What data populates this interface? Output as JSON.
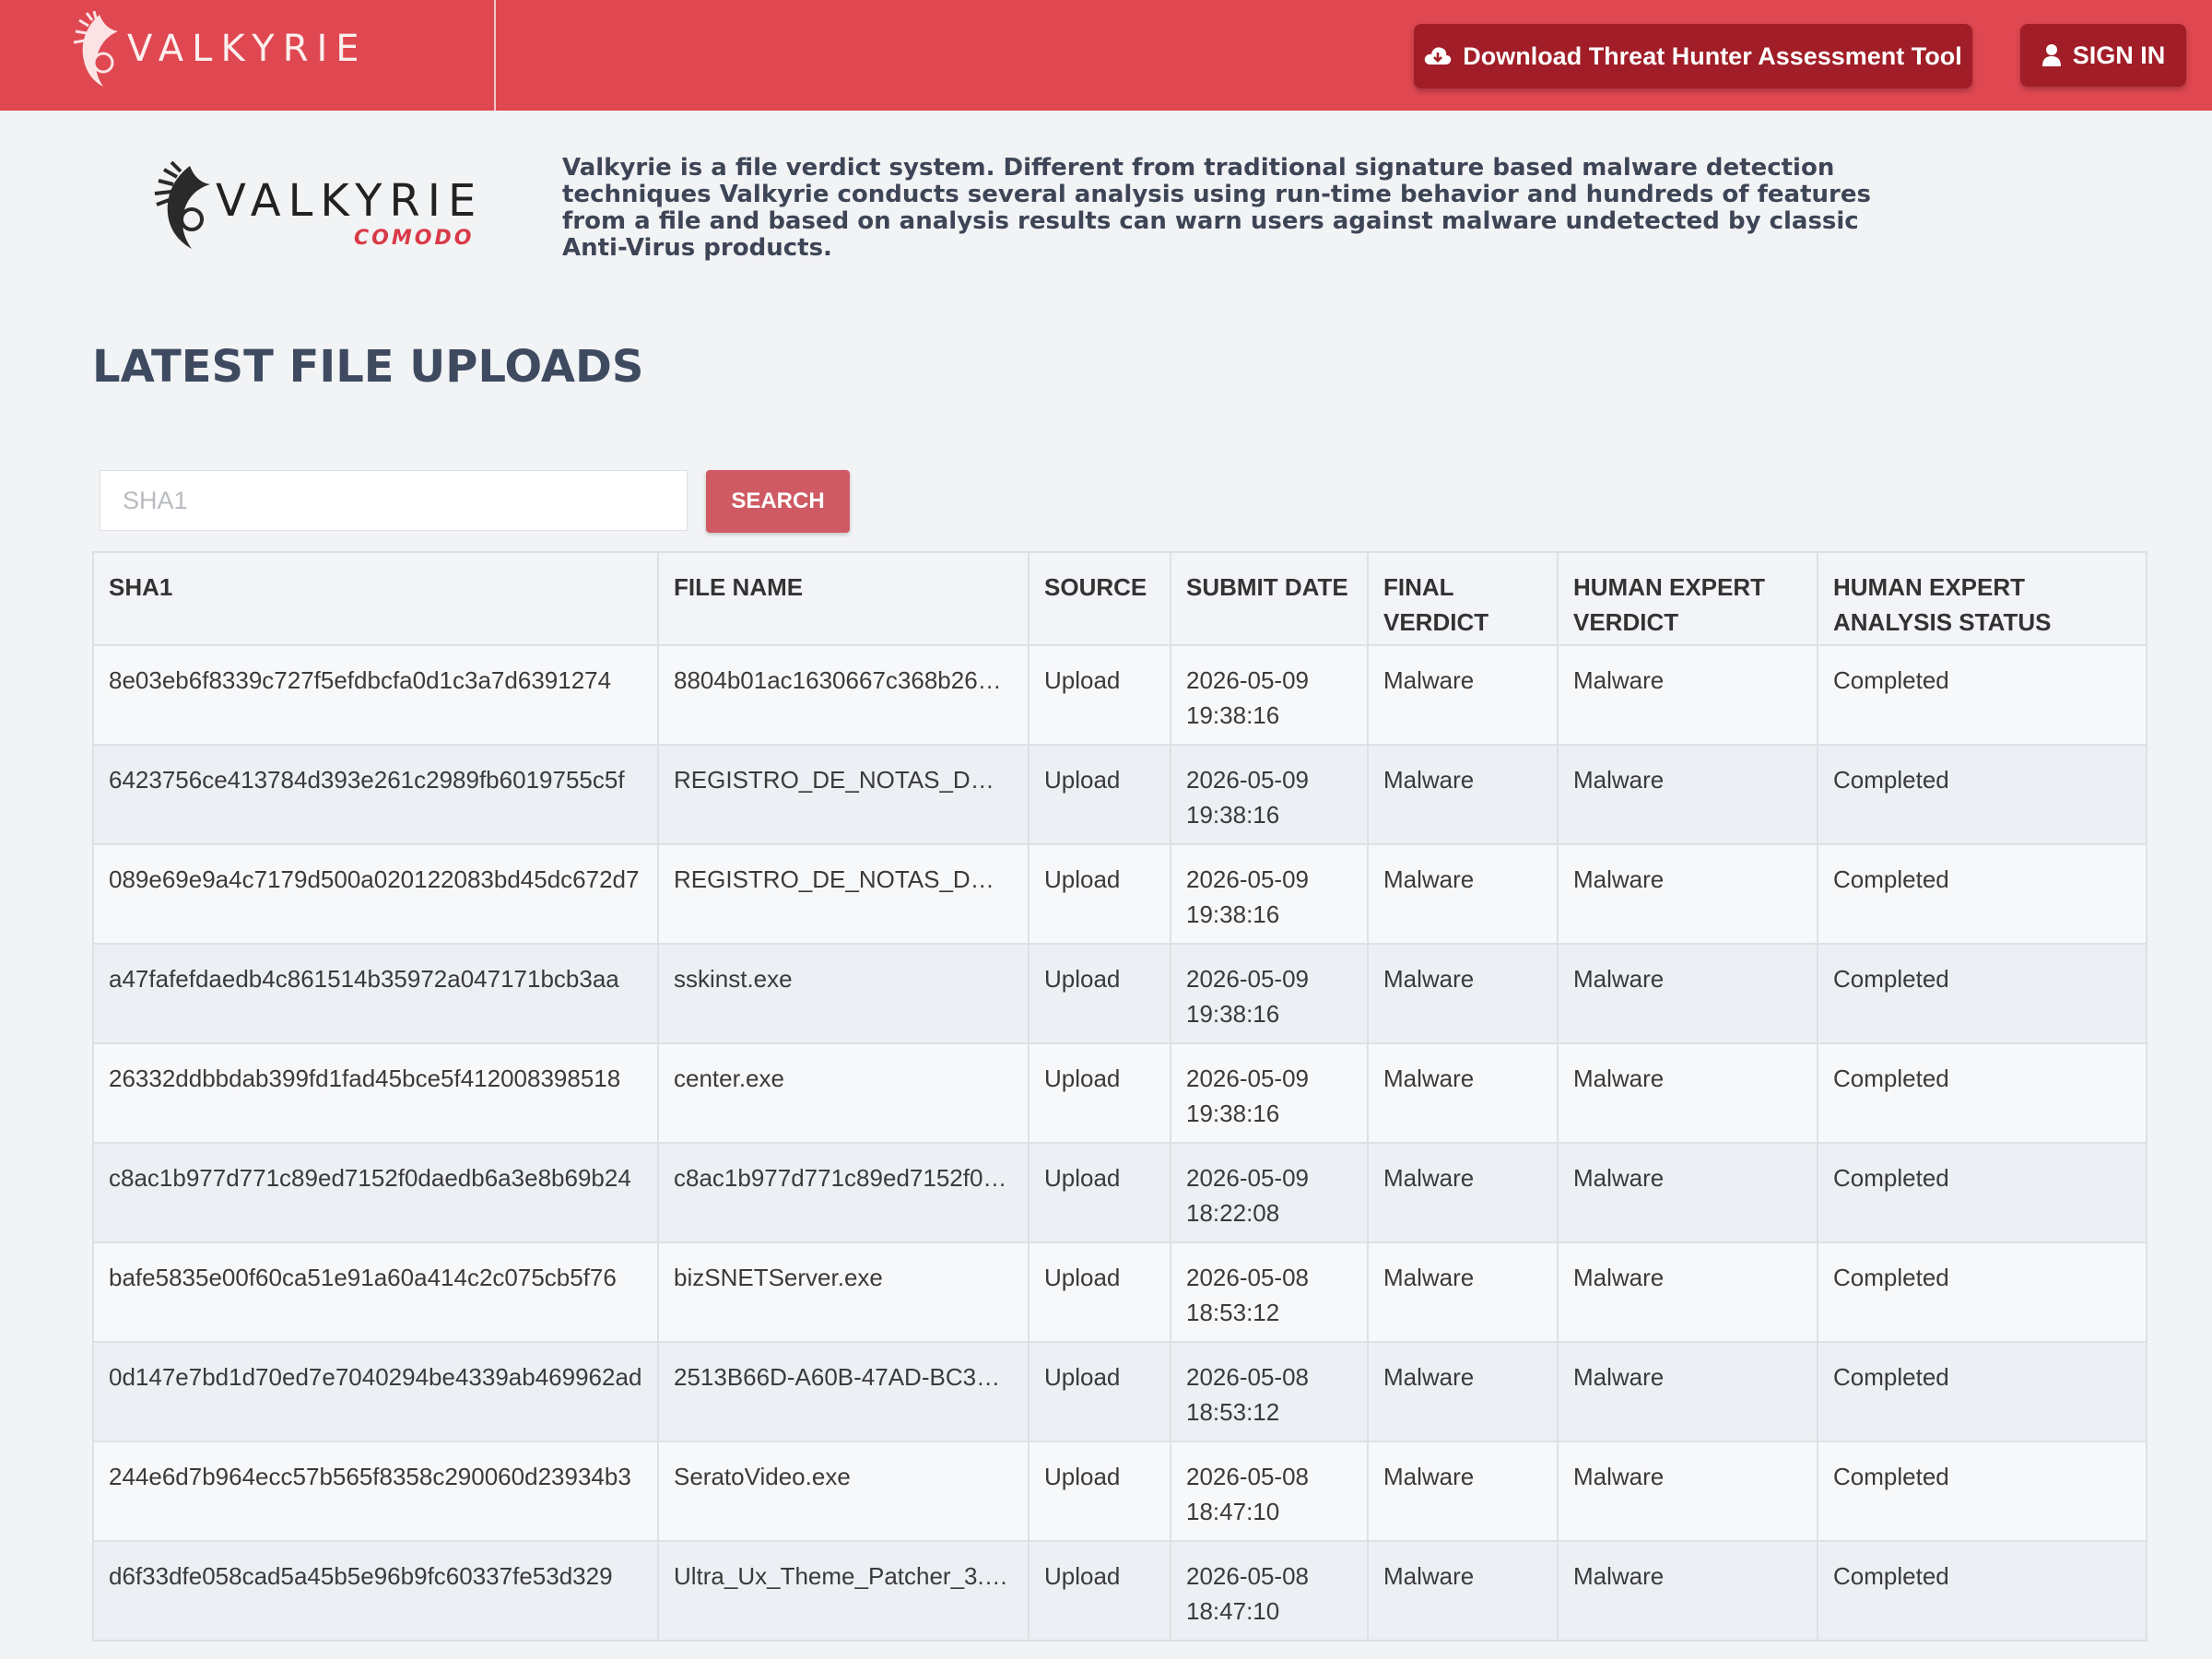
{
  "header": {
    "brand_text": "VALKYRIE",
    "download_label": "Download Threat Hunter Assessment Tool",
    "signin_label": "SIGN IN"
  },
  "intro": {
    "logo_text": "VALKYRIE",
    "logo_sub": "COMODO",
    "description": "Valkyrie is a file verdict system. Different from traditional signature based malware detection techniques Valkyrie conducts several analysis using run-time behavior and hundreds of features from a file and based on analysis results can warn users against malware undetected by classic Anti-Virus products."
  },
  "section_title": "LATEST FILE UPLOADS",
  "search": {
    "placeholder": "SHA1",
    "button_label": "SEARCH"
  },
  "table": {
    "columns": [
      "SHA1",
      "FILE NAME",
      "SOURCE",
      "SUBMIT DATE",
      "FINAL VERDICT",
      "HUMAN EXPERT VERDICT",
      "HUMAN EXPERT ANALYSIS STATUS"
    ],
    "rows": [
      {
        "sha1": "8e03eb6f8339c727f5efdbcfa0d1c3a7d6391274",
        "file_name": "8804b01ac1630667c368b26…",
        "source": "Upload",
        "date": "2026-05-09",
        "time": "19:38:16",
        "final_verdict": "Malware",
        "expert_verdict": "Malware",
        "status": "Completed"
      },
      {
        "sha1": "6423756ce413784d393e261c2989fb6019755c5f",
        "file_name": "REGISTRO_DE_NOTAS_D…",
        "source": "Upload",
        "date": "2026-05-09",
        "time": "19:38:16",
        "final_verdict": "Malware",
        "expert_verdict": "Malware",
        "status": "Completed"
      },
      {
        "sha1": "089e69e9a4c7179d500a020122083bd45dc672d7",
        "file_name": "REGISTRO_DE_NOTAS_D…",
        "source": "Upload",
        "date": "2026-05-09",
        "time": "19:38:16",
        "final_verdict": "Malware",
        "expert_verdict": "Malware",
        "status": "Completed"
      },
      {
        "sha1": "a47fafefdaedb4c861514b35972a047171bcb3aa",
        "file_name": "sskinst.exe",
        "source": "Upload",
        "date": "2026-05-09",
        "time": "19:38:16",
        "final_verdict": "Malware",
        "expert_verdict": "Malware",
        "status": "Completed"
      },
      {
        "sha1": "26332ddbbdab399fd1fad45bce5f412008398518",
        "file_name": "center.exe",
        "source": "Upload",
        "date": "2026-05-09",
        "time": "19:38:16",
        "final_verdict": "Malware",
        "expert_verdict": "Malware",
        "status": "Completed"
      },
      {
        "sha1": "c8ac1b977d771c89ed7152f0daedb6a3e8b69b24",
        "file_name": "c8ac1b977d771c89ed7152f0…",
        "source": "Upload",
        "date": "2026-05-09",
        "time": "18:22:08",
        "final_verdict": "Malware",
        "expert_verdict": "Malware",
        "status": "Completed"
      },
      {
        "sha1": "bafe5835e00f60ca51e91a60a414c2c075cb5f76",
        "file_name": "bizSNETServer.exe",
        "source": "Upload",
        "date": "2026-05-08",
        "time": "18:53:12",
        "final_verdict": "Malware",
        "expert_verdict": "Malware",
        "status": "Completed"
      },
      {
        "sha1": "0d147e7bd1d70ed7e7040294be4339ab469962ad",
        "file_name": "2513B66D-A60B-47AD-BC3…",
        "source": "Upload",
        "date": "2026-05-08",
        "time": "18:53:12",
        "final_verdict": "Malware",
        "expert_verdict": "Malware",
        "status": "Completed"
      },
      {
        "sha1": "244e6d7b964ecc57b565f8358c290060d23934b3",
        "file_name": "SeratoVideo.exe",
        "source": "Upload",
        "date": "2026-05-08",
        "time": "18:47:10",
        "final_verdict": "Malware",
        "expert_verdict": "Malware",
        "status": "Completed"
      },
      {
        "sha1": "d6f33dfe058cad5a45b5e96b9fc60337fe53d329",
        "file_name": "Ultra_Ux_Theme_Patcher_3.…",
        "source": "Upload",
        "date": "2026-05-08",
        "time": "18:47:10",
        "final_verdict": "Malware",
        "expert_verdict": "Malware",
        "status": "Completed"
      }
    ]
  },
  "icons": {
    "download": "cloud-download-icon",
    "signin": "user-icon"
  },
  "colors": {
    "brand": "#df4751",
    "button_dark": "#a11d27",
    "search_button": "#cf5a63",
    "heading": "#3d4a60"
  }
}
